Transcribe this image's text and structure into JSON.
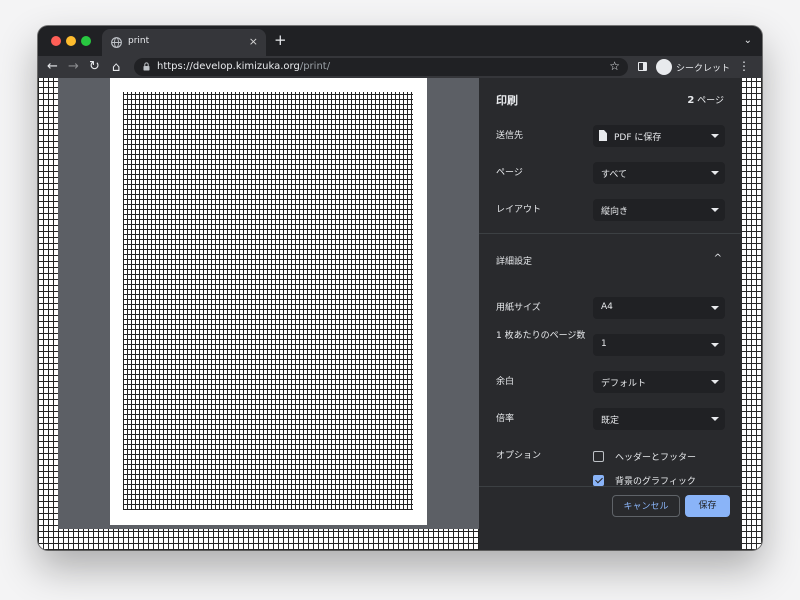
{
  "tab": {
    "title": "print",
    "close": "×",
    "new_tab": "+",
    "tab_menu": "⌄"
  },
  "toolbar": {
    "back": "←",
    "forward": "→",
    "reload": "↻",
    "home": "⌂",
    "url_host": "https://develop.kimizuka.org",
    "url_path": "/print/",
    "star": "☆",
    "profile_label": "シークレット",
    "menu": "⋮"
  },
  "print_panel": {
    "title": "印刷",
    "page_count_number": "2",
    "page_count_unit": " ページ",
    "destination": {
      "label": "送信先",
      "value": "PDF に保存"
    },
    "pages": {
      "label": "ページ",
      "value": "すべて"
    },
    "layout": {
      "label": "レイアウト",
      "value": "縦向き"
    },
    "advanced": {
      "label": "詳細設定",
      "chevron": "^"
    },
    "paper_size": {
      "label": "用紙サイズ",
      "value": "A4"
    },
    "pages_per_sheet": {
      "label": "1 枚あたりのページ数",
      "value": "1"
    },
    "margins": {
      "label": "余白",
      "value": "デフォルト"
    },
    "scale": {
      "label": "倍率",
      "value": "既定"
    },
    "options": {
      "label": "オプション",
      "headers_footers": {
        "label": "ヘッダーとフッター",
        "checked": false
      },
      "background_graphics": {
        "label": "背景のグラフィック",
        "checked": true
      }
    },
    "cancel_label": "キャンセル",
    "save_label": "保存"
  },
  "colors": {
    "accent": "#8ab4f8",
    "panel_bg": "#292a2d",
    "preview_bg": "#5c5f65"
  }
}
